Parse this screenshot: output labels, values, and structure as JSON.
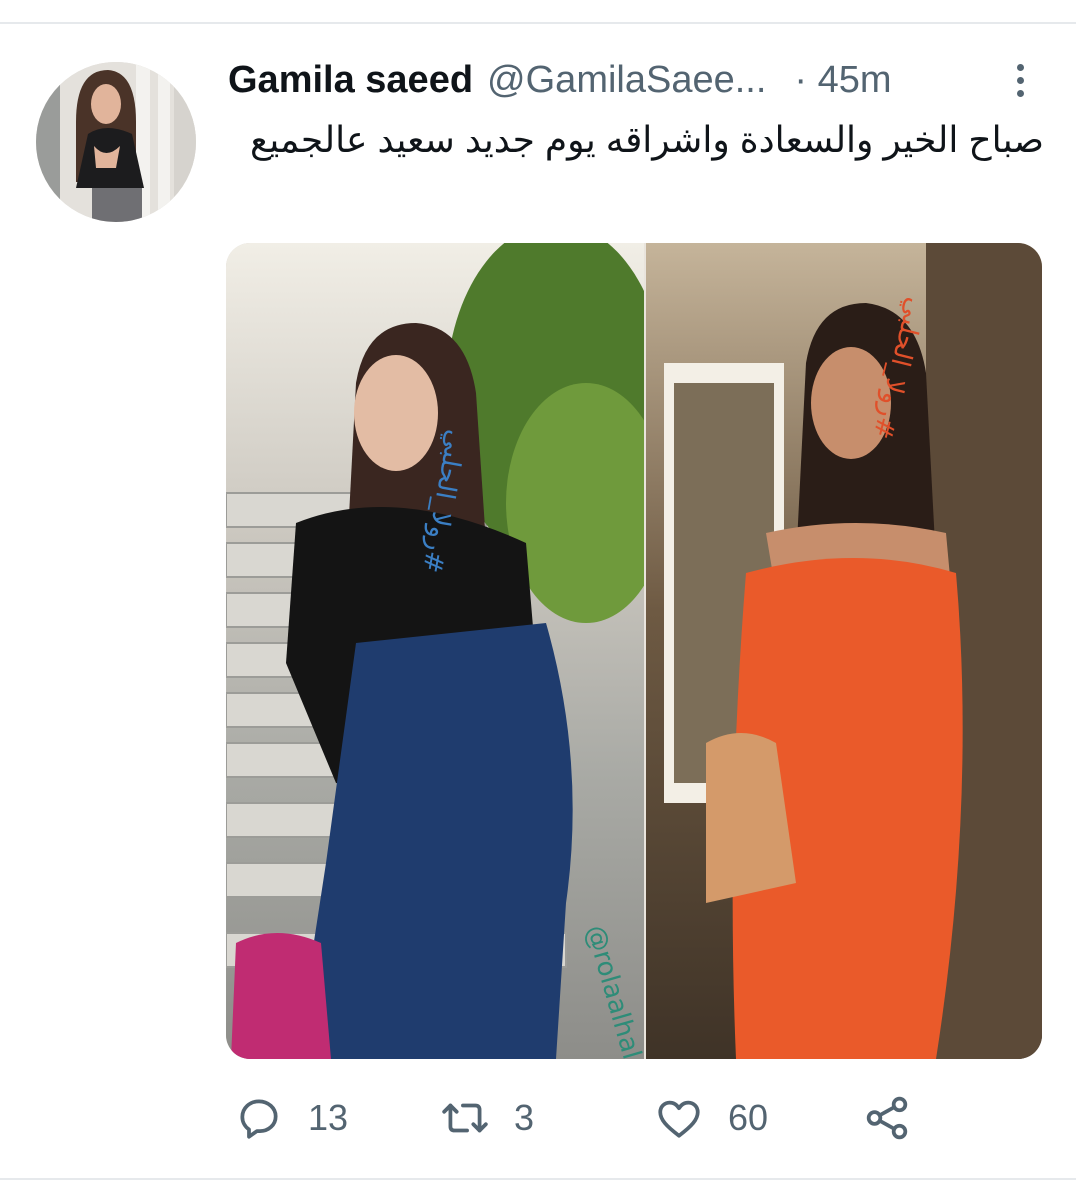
{
  "tweet": {
    "display_name": "Gamila saeed",
    "handle": "@GamilaSaee...",
    "time": "· 45m",
    "text": "صباح الخير والسعادة واشراقه يوم جديد سعيد عالجميع"
  },
  "media": {
    "watermark_handle": "@rolaalhalaby",
    "watermark_tag": "#رولا_الحلبي"
  },
  "actions": {
    "replies": "13",
    "retweets": "3",
    "likes": "60"
  },
  "icons": {
    "more": "more-vertical-icon",
    "reply": "reply-icon",
    "retweet": "retweet-icon",
    "like": "heart-icon",
    "share": "share-icon"
  },
  "colors": {
    "text": "#0f1419",
    "secondary": "#536471",
    "divider": "#e6e9ec"
  }
}
